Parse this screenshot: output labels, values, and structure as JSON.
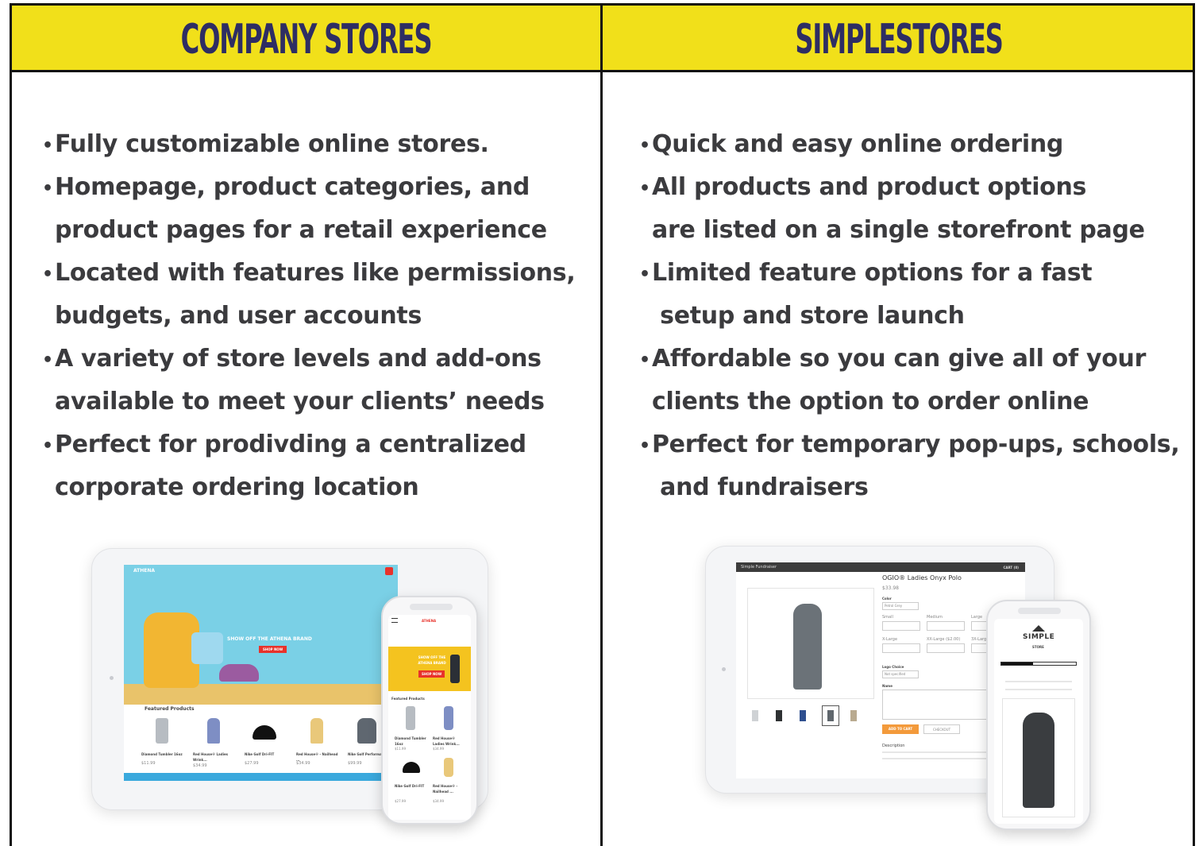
{
  "left_column": {
    "title": "COMPANY STORES",
    "bullets": [
      [
        "Fully customizable online stores."
      ],
      [
        "Homepage, product categories, and",
        "product pages for a retail experience"
      ],
      [
        "Located with features like permissions,",
        "budgets, and user accounts"
      ],
      [
        "A variety of store levels and add-ons",
        "available to meet your clients’ needs"
      ],
      [
        "Perfect for prodivding a centralized",
        "corporate ordering location"
      ]
    ],
    "mockup": {
      "hero_text": "SHOW OFF THE ATHENA BRAND",
      "hero_button": "SHOP NOW",
      "featured_label": "Featured Products",
      "products": [
        {
          "name": "Diamond Tumbler 16oz",
          "price": "$11.99"
        },
        {
          "name": "Red House® Ladies Wrink...",
          "price": "$34.99"
        },
        {
          "name": "Nike Golf Dri-FIT",
          "price": "$27.99"
        },
        {
          "name": "Red House® - Nailhead ...",
          "price": "$34.99"
        },
        {
          "name": "Nike Golf Performanc",
          "price": "$99.99"
        }
      ],
      "phone_hero_text": "SHOW OFF THE ATHENA BRAND",
      "phone_button": "SHOP NOW",
      "phone_featured_label": "Featured Products",
      "phone_products": [
        {
          "name": "Diamond Tumbler 16oz",
          "price": "$11.99"
        },
        {
          "name": "Red House® Ladies Wrink...",
          "price": "$34.99"
        },
        {
          "name": "Nike Golf Dri-FIT",
          "price": "$27.99"
        },
        {
          "name": "Red House® - Nailhead ...",
          "price": "$34.99"
        }
      ],
      "brand": "ATHENA",
      "accent_color": "#e8322b",
      "hero_color": "#7ad0e6"
    }
  },
  "right_column": {
    "title": "SIMPLESTORES",
    "bullets": [
      [
        "Quick and easy online ordering"
      ],
      [
        "All products and product options",
        "are listed on a single storefront page"
      ],
      [
        "Limited feature options for a fast",
        " setup and store launch"
      ],
      [
        "Affordable so you can give all of your",
        "clients the option to order online"
      ],
      [
        "Perfect for temporary pop-ups, schools,",
        " and fundraisers"
      ]
    ],
    "mockup": {
      "store_name": "Simple Fundraiser",
      "cart_label": "CART (0)",
      "product_title": "OGIO® Ladies Onyx Polo",
      "price": "$33.98",
      "color_label": "Color",
      "color_value": "Petrol Grey",
      "sizes": [
        "Small",
        "Medium",
        "Large",
        "X-Large",
        "XX-Large ($2.00)",
        "3X-Large"
      ],
      "logo_label": "Logo Choice",
      "logo_value": "Not specified",
      "name_label": "Name",
      "add_to_cart": "ADD TO CART",
      "checkout": "CHECKOUT",
      "description_label": "Description",
      "phone_logo": "SIMPLE",
      "phone_logo_sub": "STORE",
      "accent_color": "#f39a3b"
    }
  },
  "colors": {
    "header_yellow": "#f1e01a",
    "title_navy": "#2e2d63",
    "body_text": "#3b3b3e",
    "border": "#111111"
  }
}
